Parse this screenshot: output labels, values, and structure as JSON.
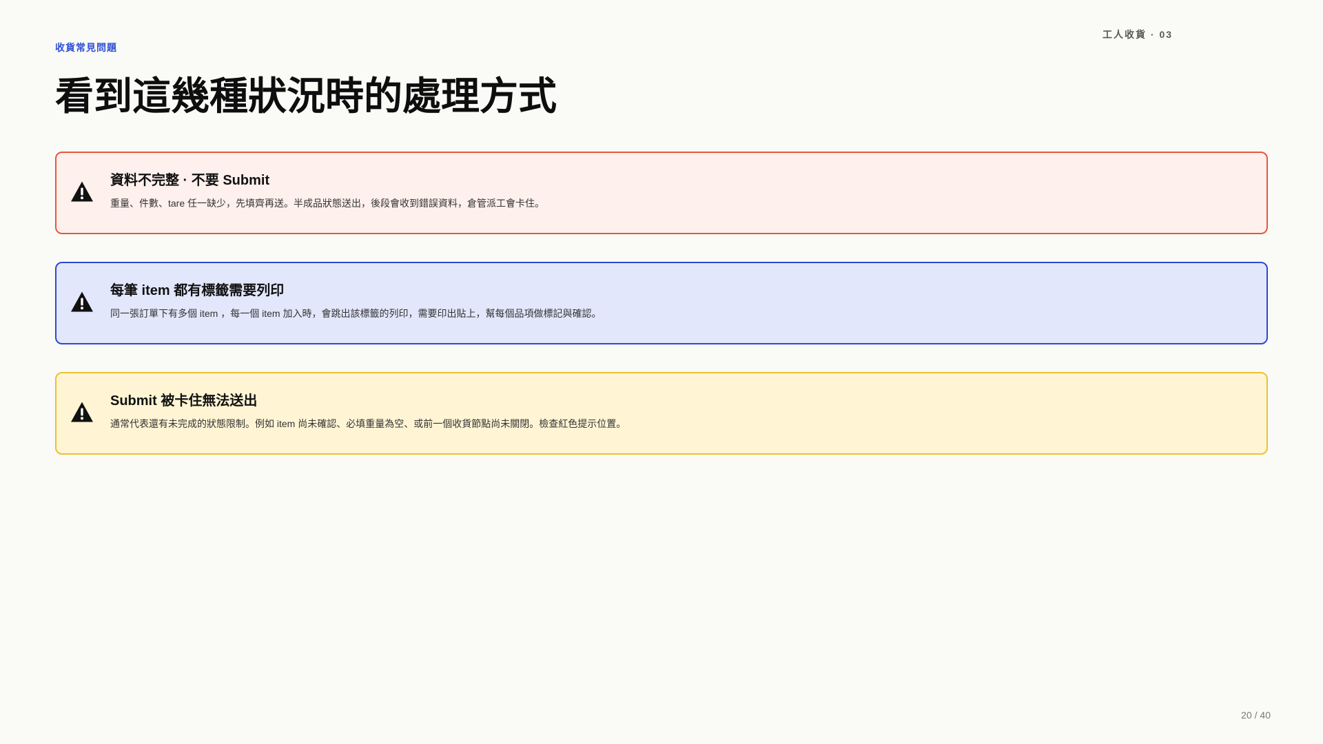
{
  "header": {
    "section_tag": "收貨常見問題",
    "deck_label": "工人收貨 · 03",
    "title": "看到這幾種狀況時的處理方式"
  },
  "cards": [
    {
      "variant": "danger",
      "icon": "warning-triangle-icon",
      "title": "資料不完整 · 不要 Submit",
      "body": "重量、件數、tare 任一缺少，先填齊再送。半成品狀態送出，後段會收到錯誤資料，倉管派工會卡住。",
      "background": "#fef0ec",
      "border": "#e8553c"
    },
    {
      "variant": "info",
      "icon": "warning-triangle-icon",
      "title": "每筆 item 都有標籤需要列印",
      "body": "同一張訂單下有多個 item ，每一個 item 加入時，會跳出該標籤的列印，需要印出貼上，幫每個品項做標記與確認。",
      "background": "#e2e7fc",
      "border": "#2d47d4"
    },
    {
      "variant": "warning",
      "icon": "warning-triangle-icon",
      "title": "Submit 被卡住無法送出",
      "body": "通常代表還有未完成的狀態限制。例如 item 尚未確認、必填重量為空、或前一個收貨節點尚未關閉。檢查紅色提示位置。",
      "background": "#fff5d4",
      "border": "#ecc12d"
    }
  ],
  "footer": {
    "page_counter": "20 / 40"
  },
  "colors": {
    "accent": "#2f4fd6",
    "page_background": "#fafaf7"
  }
}
